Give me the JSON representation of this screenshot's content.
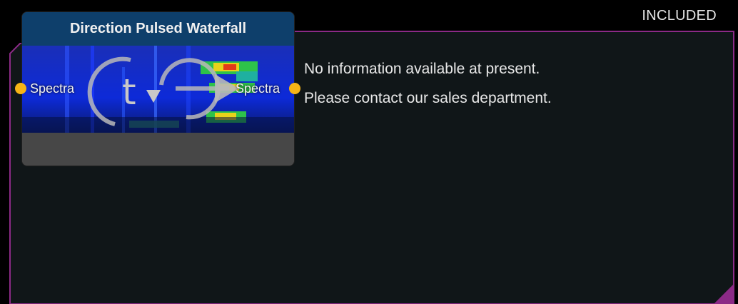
{
  "badge": {
    "label": "INCLUDED"
  },
  "node": {
    "title": "Direction Pulsed Waterfall",
    "input_port_label": "Spectra",
    "output_port_label": "Spectra",
    "icon": "time-direction-icon",
    "port_color": "#f7b416",
    "header_color": "#0e3f6b"
  },
  "info": {
    "line1": "No information available at present.",
    "line2": "Please contact our sales department."
  },
  "colors": {
    "panel_border": "#8b2a86",
    "panel_bg": "#101618"
  }
}
